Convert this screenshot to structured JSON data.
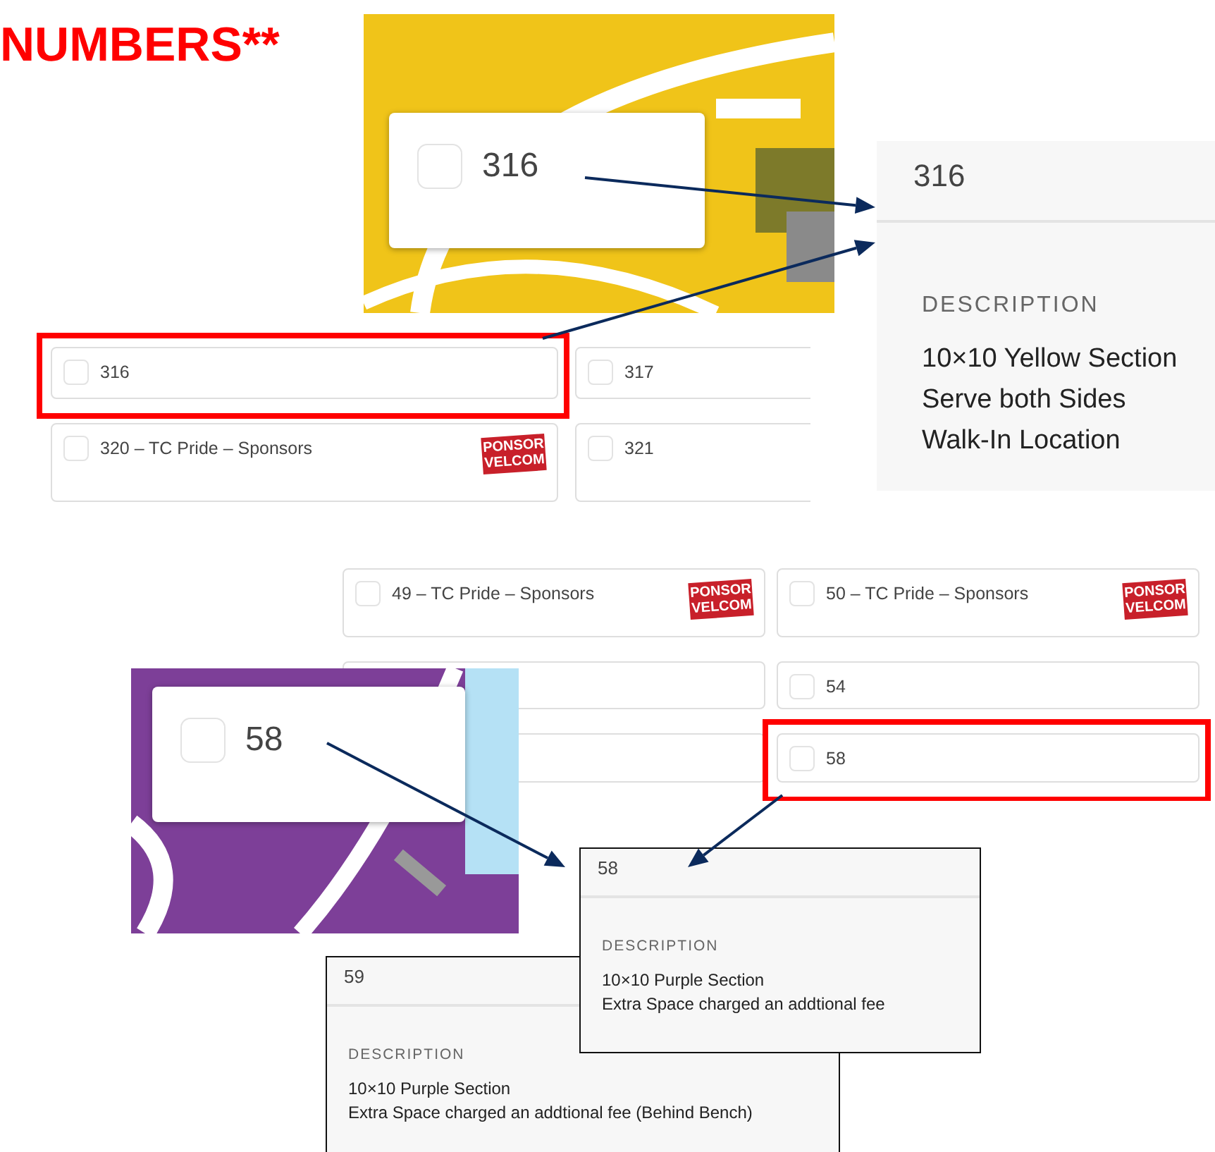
{
  "title": "NUMBERS**",
  "yellow_map": {
    "popup": {
      "label": "316",
      "checked": false
    }
  },
  "detail_316": {
    "header": "316",
    "section_label": "DESCRIPTION",
    "lines": [
      "10×10 Yellow Section",
      "Serve both Sides",
      "Walk-In Location"
    ]
  },
  "upper_grid": {
    "cards": [
      {
        "label": "316",
        "checked": false,
        "highlighted": true
      },
      {
        "label": "317",
        "checked": false,
        "highlighted": false
      },
      {
        "label": "320 – TC Pride – Sponsors",
        "checked": false,
        "highlighted": false,
        "sponsor_logo": [
          "PONSOR",
          "VELCOM"
        ]
      },
      {
        "label": "321",
        "checked": false,
        "highlighted": false
      }
    ]
  },
  "lower_grid": {
    "cards": [
      {
        "label": "49 – TC Pride – Sponsors",
        "checked": false,
        "highlighted": false,
        "sponsor_logo": [
          "PONSOR",
          "VELCOM"
        ]
      },
      {
        "label": "50 – TC Pride – Sponsors",
        "checked": false,
        "highlighted": false,
        "sponsor_logo": [
          "PONSOR",
          "VELCOM"
        ]
      },
      {
        "highlighted": false
      },
      {
        "label": "54",
        "checked": false,
        "highlighted": false
      },
      {
        "highlighted": false
      },
      {
        "label": "58",
        "checked": false,
        "highlighted": true
      }
    ]
  },
  "purple_map": {
    "popup": {
      "label": "58",
      "checked": false
    }
  },
  "detail_59": {
    "header": "59",
    "section_label": "DESCRIPTION",
    "lines": [
      "10×10 Purple Section",
      "Extra Space charged an addtional fee (Behind Bench)"
    ]
  },
  "detail_58": {
    "header": "58",
    "section_label": "DESCRIPTION",
    "lines": [
      "10×10 Purple Section",
      "Extra Space charged an addtional fee"
    ]
  }
}
